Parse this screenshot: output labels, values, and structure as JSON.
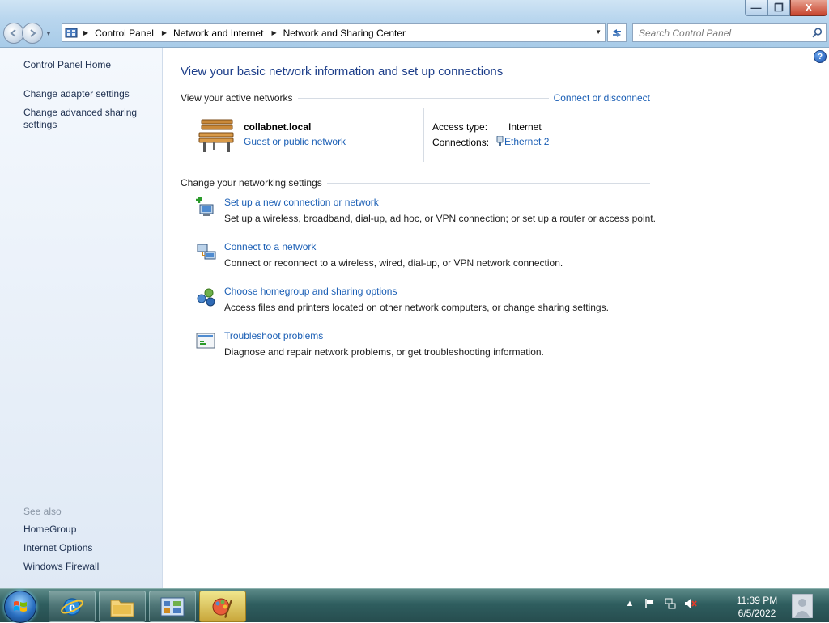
{
  "window": {
    "minimize_label": "—",
    "maximize_label": "❐",
    "close_label": "X"
  },
  "address": {
    "breadcrumbs": [
      "Control Panel",
      "Network and Internet",
      "Network and Sharing Center"
    ]
  },
  "search": {
    "placeholder": "Search Control Panel"
  },
  "sidebar": {
    "items": [
      {
        "label": "Control Panel Home"
      },
      {
        "label": "Change adapter settings"
      },
      {
        "label": "Change advanced sharing settings"
      }
    ],
    "see_also_label": "See also",
    "see_also": [
      {
        "label": "HomeGroup"
      },
      {
        "label": "Internet Options"
      },
      {
        "label": "Windows Firewall"
      }
    ]
  },
  "main": {
    "title": "View your basic network information and set up connections",
    "active_networks_heading": "View your active networks",
    "connect_disconnect": "Connect or disconnect",
    "network": {
      "name": "collabnet.local",
      "type": "Guest or public network",
      "access_type_label": "Access type:",
      "access_type_value": "Internet",
      "connections_label": "Connections:",
      "connections_value": "Ethernet 2"
    },
    "settings_heading": "Change your networking settings",
    "tasks": [
      {
        "title": "Set up a new connection or network",
        "desc": "Set up a wireless, broadband, dial-up, ad hoc, or VPN connection; or set up a router or access point.",
        "icon": "new-connection-icon"
      },
      {
        "title": "Connect to a network",
        "desc": "Connect or reconnect to a wireless, wired, dial-up, or VPN network connection.",
        "icon": "connect-network-icon"
      },
      {
        "title": "Choose homegroup and sharing options",
        "desc": "Access files and printers located on other network computers, or change sharing settings.",
        "icon": "homegroup-icon"
      },
      {
        "title": "Troubleshoot problems",
        "desc": "Diagnose and repair network problems, or get troubleshooting information.",
        "icon": "troubleshoot-icon"
      }
    ]
  },
  "taskbar": {
    "time": "11:39 PM",
    "date": "6/5/2022"
  }
}
